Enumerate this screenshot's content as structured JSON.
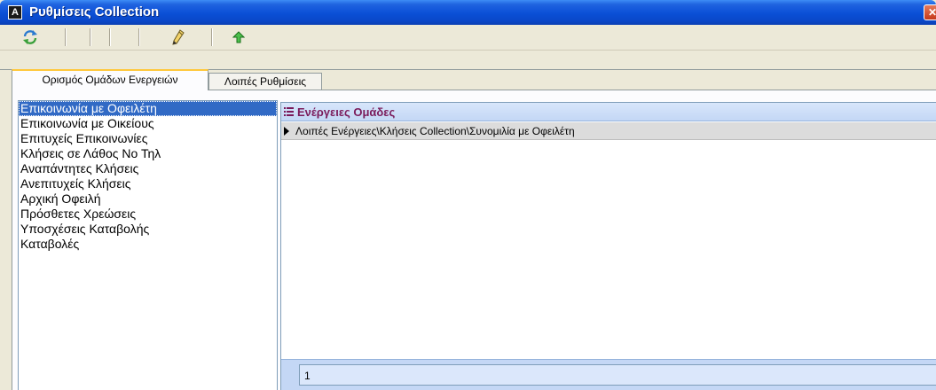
{
  "window": {
    "title": "Ρυθμίσεις Collection",
    "app_icon_letter": "A",
    "close_glyph": "✕",
    "colors": {
      "titlebar": "#0a4fd6",
      "selection": "#316ac5",
      "grid_header_text": "#7a1a5a"
    }
  },
  "toolbar": {
    "buttons": [
      {
        "icon": "refresh-icon"
      },
      {
        "icon": "edit-pencil-icon"
      },
      {
        "icon": "arrow-up-icon"
      }
    ]
  },
  "tabs": [
    {
      "label": "Ορισμός Ομάδων Ενεργειών",
      "active": true
    },
    {
      "label": "Λοιπές Ρυθμίσεις",
      "active": false
    }
  ],
  "groups": {
    "items": [
      "Επικοινωνία με Οφειλέτη",
      "Επικοινωνία με Οικείους",
      "Επιτυχείς Επικοινωνίες",
      "Κλήσεις σε Λάθος Νο Τηλ",
      "Αναπάντητες Κλήσεις",
      "Ανεπιτυχείς Κλήσεις",
      "Αρχική Οφειλή",
      "Πρόσθετες Χρεώσεις",
      "Υποσχέσεις Καταβολής",
      "Καταβολές"
    ],
    "selected_index": 0
  },
  "grid": {
    "column_header": "Ενέργειες Ομάδες",
    "rows": [
      "Λοιπές Ενέργειες\\Κλήσεις Collection\\Συνομιλία με Οφειλέτη"
    ],
    "footer_count": "1"
  }
}
